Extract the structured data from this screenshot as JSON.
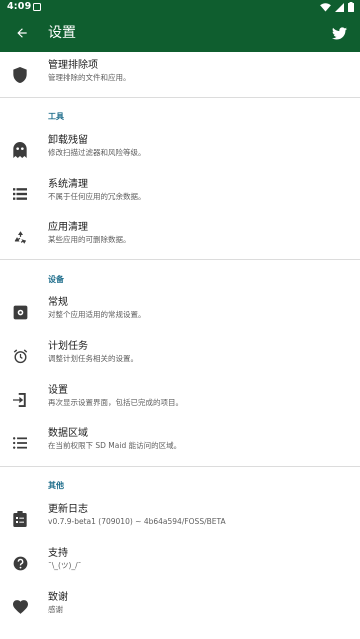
{
  "status_bar": {
    "time": "4:09"
  },
  "app_bar": {
    "title": "设置"
  },
  "items": {
    "exclusions": {
      "title": "管理排除项",
      "subtitle": "管理排除的文件和应用。"
    },
    "corpse": {
      "title": "卸载残留",
      "subtitle": "修改扫描过滤器和风险等级。"
    },
    "system_cleaner": {
      "title": "系统清理",
      "subtitle": "不属于任何应用的冗余数据。"
    },
    "app_cleaner": {
      "title": "应用清理",
      "subtitle": "某些应用的可删除数据。"
    },
    "general": {
      "title": "常规",
      "subtitle": "对整个应用适用的常规设置。"
    },
    "scheduler": {
      "title": "计划任务",
      "subtitle": "调整计划任务相关的设置。"
    },
    "setup": {
      "title": "设置",
      "subtitle": "再次显示设置界面，包括已完成的项目。"
    },
    "data_areas": {
      "title": "数据区域",
      "subtitle": "在当前权限下 SD Maid 能访问的区域。"
    },
    "changelog": {
      "title": "更新日志",
      "subtitle": "v0.7.9-beta1 (709010) ~ 4b64a594/FOSS/BETA"
    },
    "support": {
      "title": "支持",
      "subtitle": "¯\\_(ツ)_/¯"
    },
    "thanks": {
      "title": "致谢",
      "subtitle": "感谢"
    }
  },
  "sections": {
    "tools": "工具",
    "device": "设备",
    "other": "其他"
  },
  "colors": {
    "app_bar": "#0f5e2f",
    "section_header": "#1f6e8c",
    "icon": "#3c3c3c"
  }
}
